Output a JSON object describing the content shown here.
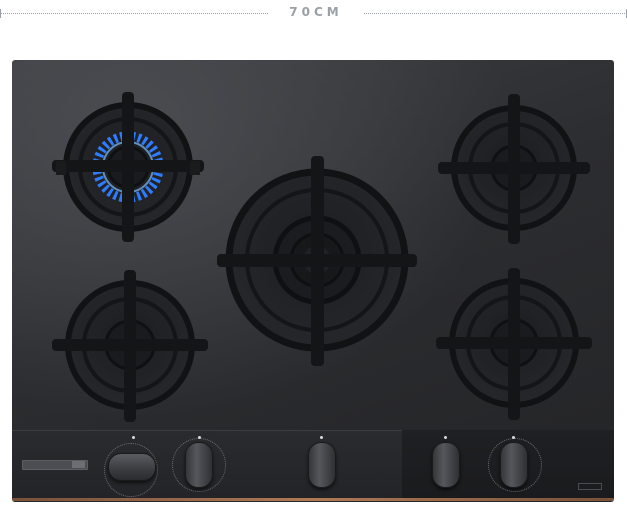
{
  "dimension": {
    "label": "70CM"
  },
  "hob": {
    "burners": [
      {
        "name": "rear-left",
        "lit": true
      },
      {
        "name": "center-wok",
        "lit": false
      },
      {
        "name": "rear-right",
        "lit": false
      },
      {
        "name": "front-left",
        "lit": false
      },
      {
        "name": "front-right",
        "lit": false
      }
    ],
    "knob_count": 5,
    "colors": {
      "flame": "#2f7dff",
      "glass": "#2c2d30",
      "trim": "#b07a55"
    }
  }
}
